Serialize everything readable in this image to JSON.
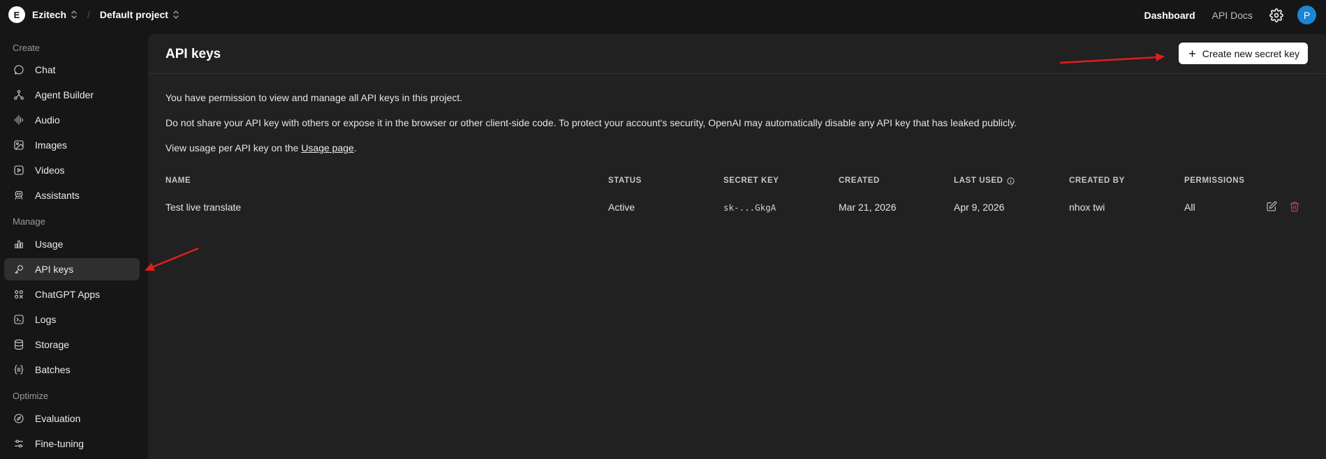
{
  "org": {
    "initial": "E",
    "name": "Ezitech"
  },
  "project": {
    "name": "Default project",
    "separator": "/"
  },
  "topnav": {
    "dashboard": "Dashboard",
    "api_docs": "API Docs",
    "avatar_initial": "P"
  },
  "sidebar": {
    "sections": [
      {
        "label": "Create",
        "items": [
          {
            "label": "Chat",
            "icon": "chat-icon"
          },
          {
            "label": "Agent Builder",
            "icon": "agent-builder-icon"
          },
          {
            "label": "Audio",
            "icon": "audio-icon"
          },
          {
            "label": "Images",
            "icon": "images-icon"
          },
          {
            "label": "Videos",
            "icon": "videos-icon"
          },
          {
            "label": "Assistants",
            "icon": "assistants-icon"
          }
        ]
      },
      {
        "label": "Manage",
        "items": [
          {
            "label": "Usage",
            "icon": "usage-icon"
          },
          {
            "label": "API keys",
            "icon": "key-icon",
            "active": true
          },
          {
            "label": "ChatGPT Apps",
            "icon": "apps-icon"
          },
          {
            "label": "Logs",
            "icon": "logs-icon"
          },
          {
            "label": "Storage",
            "icon": "storage-icon"
          },
          {
            "label": "Batches",
            "icon": "batches-icon"
          }
        ]
      },
      {
        "label": "Optimize",
        "items": [
          {
            "label": "Evaluation",
            "icon": "evaluation-icon"
          },
          {
            "label": "Fine-tuning",
            "icon": "fine-tuning-icon"
          }
        ]
      }
    ]
  },
  "main": {
    "title": "API keys",
    "create_button": "Create new secret key",
    "info_1": "You have permission to view and manage all API keys in this project.",
    "info_2": "Do not share your API key with others or expose it in the browser or other client-side code. To protect your account's security, OpenAI may automatically disable any API key that has leaked publicly.",
    "info_3_prefix": "View usage per API key on the ",
    "info_3_link": "Usage page",
    "info_3_suffix": ".",
    "table": {
      "headers": [
        "NAME",
        "STATUS",
        "SECRET KEY",
        "CREATED",
        "LAST USED",
        "CREATED BY",
        "PERMISSIONS"
      ],
      "rows": [
        {
          "name": "Test live translate",
          "status": "Active",
          "secret_key": "sk-...GkgA",
          "created": "Mar 21, 2026",
          "last_used": "Apr 9, 2026",
          "created_by": "nhox twi",
          "permissions": "All"
        }
      ]
    }
  },
  "colors": {
    "accent": "#1a86d4",
    "delete": "#e5484d",
    "arrow": "#e01e1e",
    "panel": "#212121",
    "background": "#161616"
  }
}
